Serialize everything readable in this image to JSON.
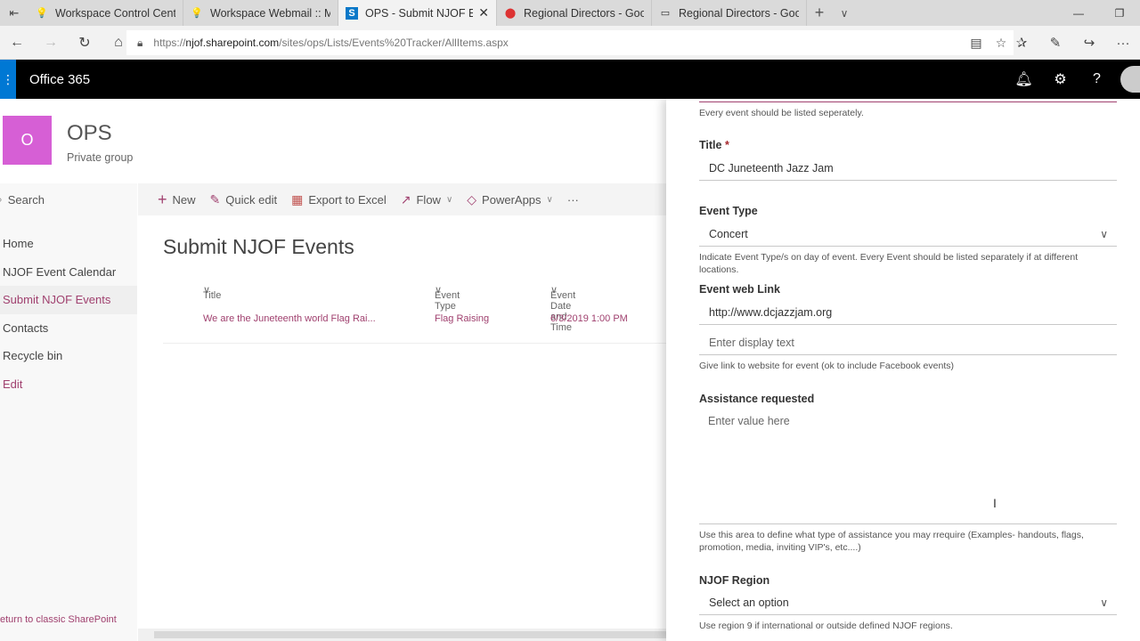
{
  "browser": {
    "tabs": [
      {
        "title": "Workspace Control Center"
      },
      {
        "title": "Workspace Webmail :: Mail"
      },
      {
        "title": "OPS - Submit NJOF Eve"
      },
      {
        "title": "Regional Directors - Google"
      },
      {
        "title": "Regional Directors - Google"
      }
    ],
    "url_prefix": "https://",
    "url_domain": "njof.sharepoint.com",
    "url_path": "/sites/ops/Lists/Events%20Tracker/AllItems.aspx"
  },
  "o365": {
    "brand": "Office 365"
  },
  "site": {
    "logo_letter": "O",
    "title": "OPS",
    "subtitle": "Private group"
  },
  "leftnav": {
    "search": "Search",
    "items": [
      "Home",
      "NJOF Event Calendar",
      "Submit NJOF Events",
      "Contacts",
      "Recycle bin",
      "Edit"
    ],
    "classic": "eturn to classic SharePoint"
  },
  "cmdbar": {
    "new": "New",
    "quick_edit": "Quick edit",
    "export": "Export to Excel",
    "flow": "Flow",
    "powerapps": "PowerApps",
    "more": "···"
  },
  "list": {
    "title": "Submit NJOF Events",
    "columns": [
      "Title",
      "Event Type",
      "Event Date and Time"
    ],
    "rows": [
      {
        "title": "We are the Juneteenth world Flag Rai...",
        "type": "Flag Raising",
        "date": "6/3/2019 1:00 PM"
      }
    ]
  },
  "form": {
    "top_help": "Every event should be listed seperately.",
    "title_label": "Title",
    "title_req": " *",
    "title_value": "DC Juneteenth Jazz Jam",
    "type_label": "Event Type",
    "type_value": "Concert",
    "type_help": "Indicate Event Type/s on day of event. Every Event should be listed separately if at different locations.",
    "link_label": "Event web Link",
    "link_value": "http://www.dcjazzjam.org",
    "link_display_placeholder": "Enter display text",
    "link_help": "Give link to website for event (ok to include Facebook events)",
    "assist_label": "Assistance requested",
    "assist_placeholder": "Enter value here",
    "assist_help": "Use this area to define what type of assistance you may rrequire (Examples- handouts, flags, promotion, media, inviting VIP's, etc....)",
    "region_label": "NJOF Region",
    "region_value": "Select an option",
    "region_help": "Use region 9 if international or outside defined NJOF regions."
  }
}
